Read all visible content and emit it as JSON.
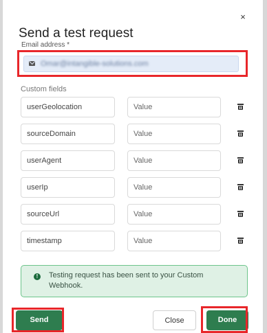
{
  "modal": {
    "title": "Send a test request",
    "close_glyph": "×",
    "close_icon": "close-icon"
  },
  "email": {
    "label": "Email address *",
    "value": "Omar@intangible-solutions.com",
    "icon": "mail-icon"
  },
  "custom_fields": {
    "label": "Custom fields",
    "value_placeholder": "Value",
    "delete_icon": "trash-icon",
    "rows": [
      {
        "key": "userGeolocation"
      },
      {
        "key": "sourceDomain"
      },
      {
        "key": "userAgent"
      },
      {
        "key": "userIp"
      },
      {
        "key": "sourceUrl"
      },
      {
        "key": "timestamp"
      }
    ]
  },
  "notice": {
    "icon": "info-icon",
    "icon_glyph": "!",
    "text": "Testing request has been sent to your Custom Webhook."
  },
  "footer": {
    "send_label": "Send",
    "close_label": "Close",
    "done_label": "Done"
  },
  "colors": {
    "primary_button": "#2e7d4f",
    "success_bg": "#dff1e5",
    "success_border": "#6cc48a",
    "highlight": "#e8262a",
    "email_field_bg": "#e4ecf8"
  }
}
